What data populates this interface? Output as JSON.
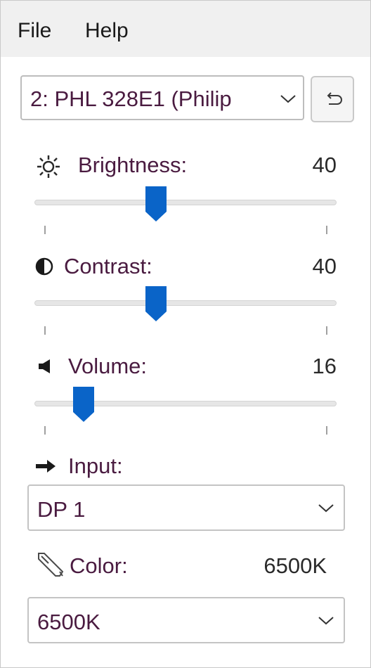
{
  "menu": {
    "file_label": "File",
    "help_label": "Help"
  },
  "monitor": {
    "selected": "2: PHL 328E1 (Philip",
    "reset_icon": "undo-icon"
  },
  "brightness": {
    "icon": "sun-icon",
    "label": "Brightness:",
    "value": "40",
    "level": 40
  },
  "contrast": {
    "icon": "contrast-icon",
    "label": "Contrast:",
    "value": "40",
    "level": 40
  },
  "volume": {
    "icon": "speaker-icon",
    "label": "Volume:",
    "value": "16",
    "level": 16
  },
  "input": {
    "icon": "arrow-right-icon",
    "label": "Input:",
    "selected": "DP 1"
  },
  "color": {
    "icon": "eyedropper-icon",
    "label": "Color:",
    "value": "6500K",
    "selected": "6500K"
  },
  "colors": {
    "accent": "#0a64c8",
    "label_text": "#4a1b40"
  }
}
